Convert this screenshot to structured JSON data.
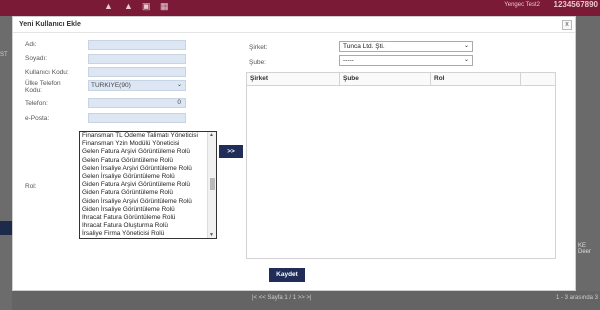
{
  "app": {
    "user_name": "Yengec Test2",
    "user_number": "1234567890",
    "left_tag": "ST",
    "right_text": "KE Deer",
    "pager": "|<  <<  Sayfa  1  / 1  >>  >|",
    "pager_right": "1 - 3 arasında 3"
  },
  "modal": {
    "title": "Yeni Kullanıcı Ekle",
    "close_label": "x",
    "labels": {
      "name": "Adı:",
      "surname": "Soyadı:",
      "username": "Kullanıcı Kodu:",
      "phone_code": "Ülke Telefon Kodu:",
      "phone": "Telefon:",
      "email": "e-Posta:",
      "role": "Rol:",
      "company": "Şirket:",
      "branch": "Şube:"
    },
    "fields": {
      "name": "",
      "surname": "",
      "username": "",
      "phone_code": "TURKIYE(90)",
      "phone": "0",
      "email": ""
    },
    "roles": [
      "Finansman TL Ödeme Talimatı Yöneticisi",
      "Finansman Yzin Modülü Yöneticisi",
      "Gelen Fatura Arşivi Görüntüleme Rolü",
      "Gelen Fatura Görüntüleme Rolü",
      "Gelen İrsaliye Arşivi Görüntüleme Rolü",
      "Gelen İrsaliye Görüntüleme Rolü",
      "Giden Fatura Arşivi Görüntüleme Rolü",
      "Giden Fatura Görüntüleme Rolü",
      "Giden İrsaliye Arşivi Görüntüleme Rolü",
      "Giden İrsaliye Görüntüleme Rolü",
      "Ihracat Fatura Görüntüleme Rolü",
      "Ihracat Fatura Oluşturma Rolü",
      "İrsaliye Firma Yöneticisi Rolü"
    ],
    "move_label": ">>",
    "company_value": "Tunca Ltd. Şti.",
    "branch_value": "-----",
    "grid_columns": [
      "Şirket",
      "Şube",
      "Rol"
    ],
    "save_label": "Kaydet"
  },
  "colors": {
    "accent": "#1f2d58",
    "topbar": "#7a1a36",
    "input_bg": "#dde7f3"
  },
  "icons": [
    "bell-icon",
    "bell-icon",
    "inbox-icon",
    "grid-icon",
    "close-icon",
    "chevron-down-icon"
  ]
}
